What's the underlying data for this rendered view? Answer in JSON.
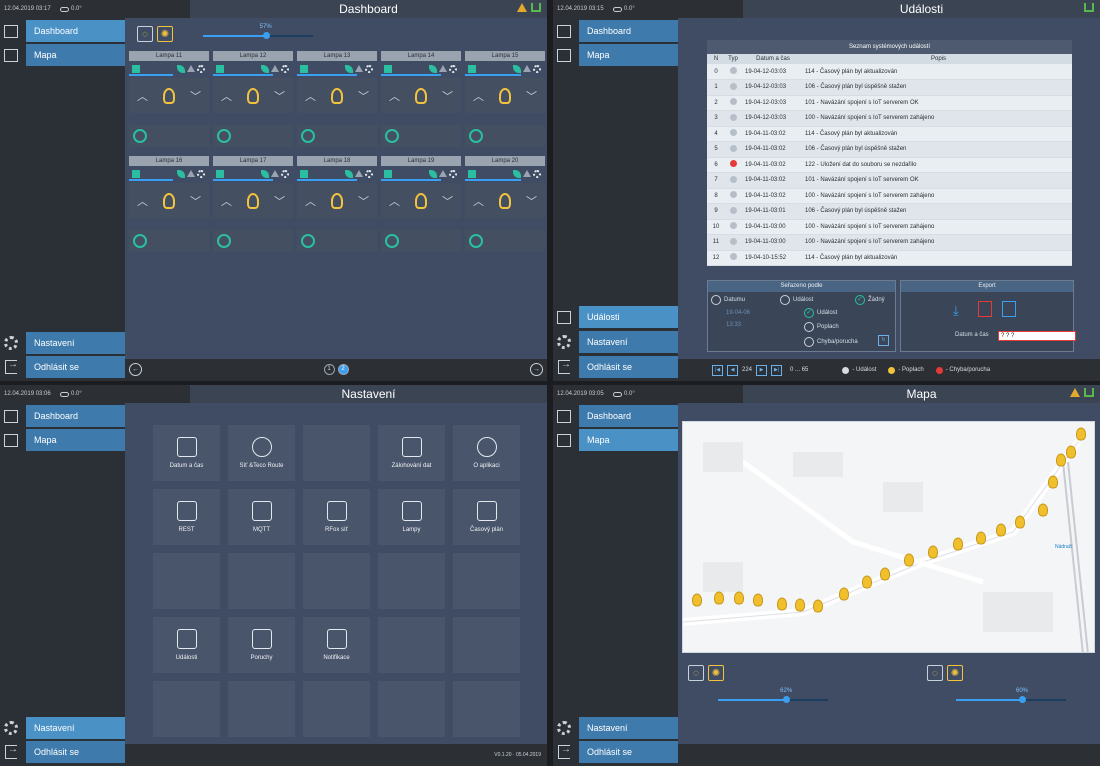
{
  "dashboard": {
    "clock": "12.04.2019 03:17",
    "temperature": "0.0°",
    "title": "Dashboard",
    "brightness_pct": "57%",
    "brightness_value": 0.57,
    "lamps": [
      {
        "name": "Lampa 11",
        "bar": 0.55
      },
      {
        "name": "Lampa 12",
        "bar": 0.75
      },
      {
        "name": "Lampa 13",
        "bar": 0.75
      },
      {
        "name": "Lampa 14",
        "bar": 0.75
      },
      {
        "name": "Lampa 15",
        "bar": 0.7
      },
      {
        "name": "Lampa 16",
        "bar": 0.55
      },
      {
        "name": "Lampa 17",
        "bar": 0.75
      },
      {
        "name": "Lampa 18",
        "bar": 0.75
      },
      {
        "name": "Lampa 19",
        "bar": 0.75
      },
      {
        "name": "Lampa 20",
        "bar": 0.7
      }
    ],
    "pages": [
      "1",
      "2"
    ],
    "current_page": "2"
  },
  "events": {
    "clock": "12.04.2019 03:15",
    "temperature": "0.0°",
    "title": "Události",
    "table_caption": "Seznam systémových událostí",
    "columns": [
      "N",
      "Typ",
      "Datum a čas",
      "Popis"
    ],
    "rows": [
      {
        "n": "0",
        "red": false,
        "dt": "19-04-12-03:03",
        "desc": "114 - Časový plán byl aktualizován"
      },
      {
        "n": "1",
        "red": false,
        "dt": "19-04-12-03:03",
        "desc": "106 - Časový plán byl úspěšně stažen"
      },
      {
        "n": "2",
        "red": false,
        "dt": "19-04-12-03:03",
        "desc": "101 - Navázání spojení s IoT serverem OK"
      },
      {
        "n": "3",
        "red": false,
        "dt": "19-04-12-03:03",
        "desc": "100 - Navázání spojení s IoT serverem zahájeno"
      },
      {
        "n": "4",
        "red": false,
        "dt": "19-04-11-03:02",
        "desc": "114 - Časový plán byl aktualizován"
      },
      {
        "n": "5",
        "red": false,
        "dt": "19-04-11-03:02",
        "desc": "106 - Časový plán byl úspěšně stažen"
      },
      {
        "n": "6",
        "red": true,
        "dt": "19-04-11-03:02",
        "desc": "122 - Uložení dat do souboru se nezdařilo"
      },
      {
        "n": "7",
        "red": false,
        "dt": "19-04-11-03:02",
        "desc": "101 - Navázání spojení s IoT serverem OK"
      },
      {
        "n": "8",
        "red": false,
        "dt": "19-04-11-03:02",
        "desc": "100 - Navázání spojení s IoT serverem zahájeno"
      },
      {
        "n": "9",
        "red": false,
        "dt": "19-04-11-03:01",
        "desc": "106 - Časový plán byl úspěšně stažen"
      },
      {
        "n": "10",
        "red": false,
        "dt": "19-04-11-03:00",
        "desc": "100 - Navázání spojení s IoT serverem zahájeno"
      },
      {
        "n": "11",
        "red": false,
        "dt": "19-04-11-03:00",
        "desc": "100 - Navázání spojení s IoT serverem zahájeno"
      },
      {
        "n": "12",
        "red": false,
        "dt": "19-04-10-15:52",
        "desc": "114 - Časový plán byl aktualizován"
      }
    ],
    "sort_title": "Seřazeno podle",
    "sort_date": "Datumu",
    "sort_date_from": "19-04-06",
    "sort_time": "13:33",
    "sort_event": "Událost",
    "sort_none": "Žádný",
    "sort_evt2": "Událost",
    "sort_alarm": "Poplach",
    "sort_fault": "Chyba/porucha",
    "export_title": "Export",
    "export_dt_label": "Datum a čas",
    "export_dt_value": "? ? ?",
    "page_number": "224",
    "range": "0 ... 65",
    "legend_event": "- Událost",
    "legend_alarm": "- Poplach",
    "legend_fault": "- Chyba/porucha"
  },
  "settings": {
    "clock": "12.04.2019 03:06",
    "temperature": "0.0°",
    "title": "Nastavení",
    "tiles": [
      {
        "label": "Datum a čas",
        "icon": "calendar-clock-icon"
      },
      {
        "label": "Síť &Teco Route",
        "icon": "ip-pin-icon"
      },
      {
        "label": "",
        "icon": ""
      },
      {
        "label": "Zálohování dat",
        "icon": "database-icon"
      },
      {
        "label": "O aplikaci",
        "icon": "chat-info-icon"
      },
      {
        "label": "REST",
        "icon": "api-gear-icon"
      },
      {
        "label": "MQTT",
        "icon": "network-nodes-icon"
      },
      {
        "label": "RFox síť",
        "icon": "antenna-icon"
      },
      {
        "label": "Lampy",
        "icon": "lamp-settings-icon"
      },
      {
        "label": "Časový plán",
        "icon": "calendar-plan-icon"
      },
      {
        "label": "",
        "icon": ""
      },
      {
        "label": "",
        "icon": ""
      },
      {
        "label": "",
        "icon": ""
      },
      {
        "label": "",
        "icon": ""
      },
      {
        "label": "",
        "icon": ""
      },
      {
        "label": "Události",
        "icon": "event-log-icon"
      },
      {
        "label": "Poruchy",
        "icon": "warning-diamond-icon"
      },
      {
        "label": "Notifikace",
        "icon": "envelope-icon"
      },
      {
        "label": "",
        "icon": ""
      },
      {
        "label": "",
        "icon": ""
      },
      {
        "label": "",
        "icon": ""
      },
      {
        "label": "",
        "icon": ""
      },
      {
        "label": "",
        "icon": ""
      },
      {
        "label": "",
        "icon": ""
      },
      {
        "label": "",
        "icon": ""
      }
    ],
    "version": "V0.1.20 · 05.04.2019"
  },
  "map": {
    "clock": "12.04.2019 03:05",
    "temperature": "0.0°",
    "title": "Mapa",
    "slider_left_pct": "62%",
    "slider_left_value": 0.62,
    "slider_right_pct": "60%",
    "slider_right_value": 0.6,
    "station_label": "Nádraží"
  },
  "nav": {
    "dashboard": "Dashboard",
    "map": "Mapa",
    "events": "Události",
    "settings": "Nastavení",
    "logout": "Odhlásit se"
  },
  "colors": {
    "accent": "#3a9ff0",
    "nav": "#3e7bac",
    "teal": "#2bbfa1",
    "bulb": "#f2c33d",
    "alarm": "#e53b36"
  }
}
